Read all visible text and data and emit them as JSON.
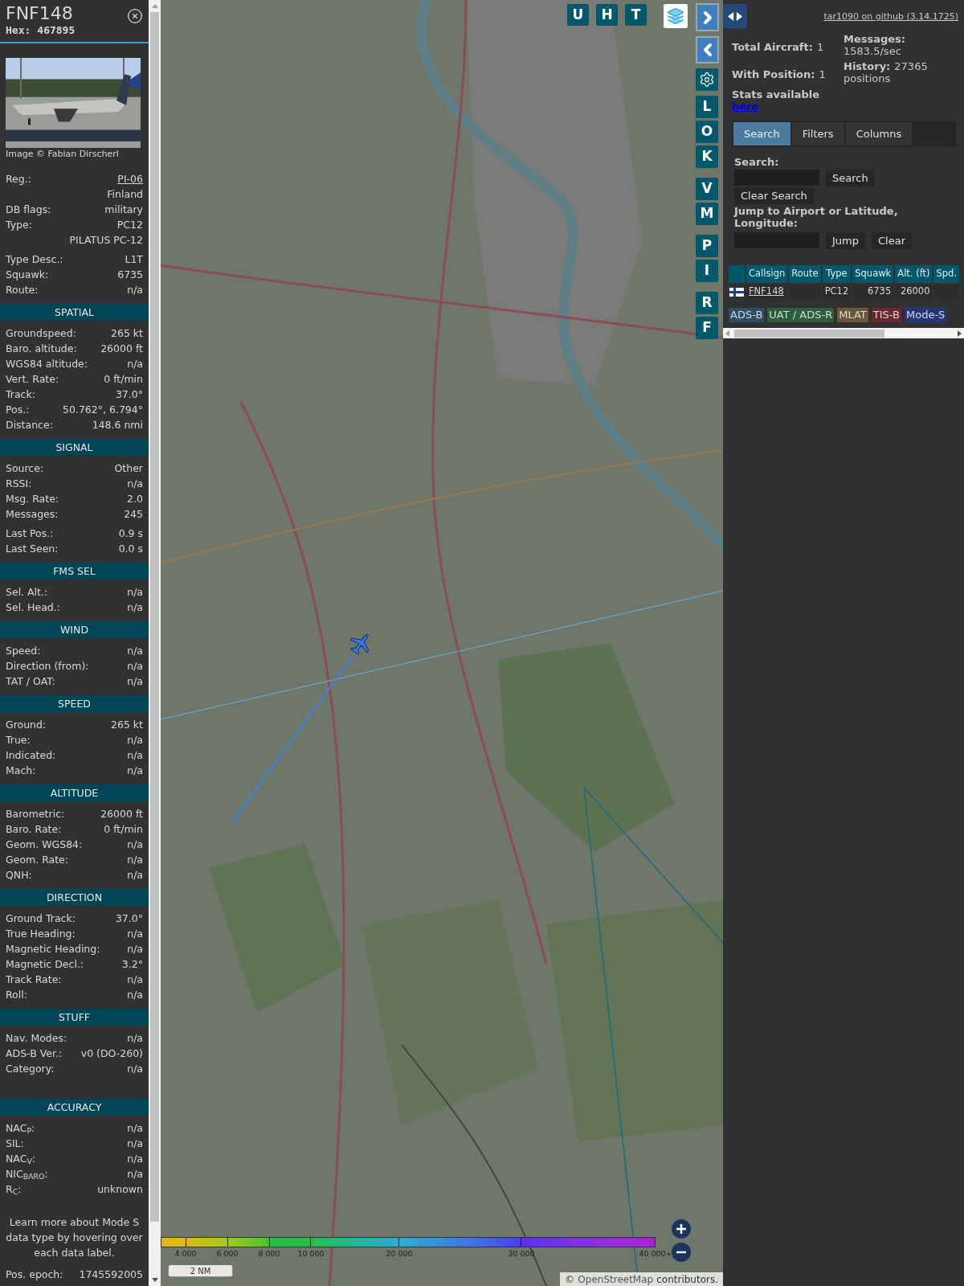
{
  "sidebar": {
    "callsign": "FNF148",
    "hex_label": "Hex:",
    "hex": "467895",
    "photo_credit": "Image © Fabian Dirscherl",
    "groups": [
      [
        {
          "label": "Reg.:",
          "values": [
            "PI-06",
            "Finland"
          ],
          "link": true
        },
        {
          "label": "DB flags:",
          "values": [
            "military"
          ]
        },
        {
          "label": "Type:",
          "values": [
            "PC12",
            "PILATUS PC-12"
          ]
        }
      ],
      [
        {
          "label": "Type Desc.:",
          "values": [
            "L1T"
          ]
        },
        {
          "label": "Squawk:",
          "values": [
            "6735"
          ]
        },
        {
          "label": "Route:",
          "values": [
            "n/a"
          ]
        }
      ]
    ],
    "sections": [
      {
        "title": "SPATIAL",
        "groups": [
          [
            {
              "label": "Groundspeed:",
              "values": [
                "265 kt"
              ]
            },
            {
              "label": "Baro. altitude:",
              "values": [
                "26000 ft"
              ]
            },
            {
              "label": "WGS84 altitude:",
              "values": [
                "n/a"
              ]
            },
            {
              "label": "Vert. Rate:",
              "values": [
                "0 ft/min"
              ]
            },
            {
              "label": "Track:",
              "values": [
                "37.0°"
              ]
            },
            {
              "label": "Pos.:",
              "values": [
                "50.762°, 6.794°"
              ]
            },
            {
              "label": "Distance:",
              "values": [
                "148.6 nmi"
              ]
            }
          ]
        ]
      },
      {
        "title": "SIGNAL",
        "groups": [
          [
            {
              "label": "Source:",
              "values": [
                "Other"
              ]
            },
            {
              "label": "RSSI:",
              "values": [
                "n/a"
              ]
            },
            {
              "label": "Msg. Rate:",
              "values": [
                "2.0"
              ]
            },
            {
              "label": "Messages:",
              "values": [
                "245"
              ]
            }
          ],
          [
            {
              "label": "Last Pos.:",
              "values": [
                "0.9 s"
              ]
            },
            {
              "label": "Last Seen:",
              "values": [
                "0.0 s"
              ]
            }
          ]
        ]
      },
      {
        "title": "FMS SEL",
        "groups": [
          [
            {
              "label": "Sel. Alt.:",
              "values": [
                "n/a"
              ]
            },
            {
              "label": "Sel. Head.:",
              "values": [
                "n/a"
              ]
            }
          ]
        ]
      },
      {
        "title": "WIND",
        "groups": [
          [
            {
              "label": "Speed:",
              "values": [
                "n/a"
              ]
            },
            {
              "label": "Direction (from):",
              "values": [
                "n/a"
              ]
            },
            {
              "label": "TAT / OAT:",
              "values": [
                "n/a"
              ]
            }
          ]
        ]
      },
      {
        "title": "SPEED",
        "groups": [
          [
            {
              "label": "Ground:",
              "values": [
                "265 kt"
              ]
            },
            {
              "label": "True:",
              "values": [
                "n/a"
              ]
            },
            {
              "label": "Indicated:",
              "values": [
                "n/a"
              ]
            },
            {
              "label": "Mach:",
              "values": [
                "n/a"
              ]
            }
          ]
        ]
      },
      {
        "title": "ALTITUDE",
        "groups": [
          [
            {
              "label": "Barometric:",
              "values": [
                "26000 ft"
              ]
            },
            {
              "label": "Baro. Rate:",
              "values": [
                "0 ft/min"
              ]
            },
            {
              "label": "Geom. WGS84:",
              "values": [
                "n/a"
              ]
            },
            {
              "label": "Geom. Rate:",
              "values": [
                "n/a"
              ]
            },
            {
              "label": "QNH:",
              "values": [
                "n/a"
              ]
            }
          ]
        ]
      },
      {
        "title": "DIRECTION",
        "groups": [
          [
            {
              "label": "Ground Track:",
              "values": [
                "37.0°"
              ]
            },
            {
              "label": "True Heading:",
              "values": [
                "n/a"
              ]
            },
            {
              "label": "Magnetic Heading:",
              "values": [
                "n/a"
              ]
            },
            {
              "label": "Magnetic Decl.:",
              "values": [
                "3.2°"
              ]
            },
            {
              "label": "Track Rate:",
              "values": [
                "n/a"
              ]
            },
            {
              "label": "Roll:",
              "values": [
                "n/a"
              ]
            }
          ]
        ]
      },
      {
        "title": "STUFF",
        "groups": [
          [
            {
              "label": "Nav. Modes:",
              "values": [
                "n/a"
              ]
            },
            {
              "label": "ADS-B Ver.:",
              "values": [
                "v0 (DO-260)"
              ]
            },
            {
              "label": "Category:",
              "values": [
                "n/a"
              ]
            }
          ]
        ]
      },
      {
        "title": "ACCURACY",
        "groups": [
          [
            {
              "label": "NAC$_{P}$:",
              "values": [
                "n/a"
              ]
            },
            {
              "label": "SIL:",
              "values": [
                "n/a"
              ]
            },
            {
              "label": "NAC$_{V}$:",
              "values": [
                "n/a"
              ]
            },
            {
              "label": "NIC$_{BARO}$:",
              "values": [
                "n/a"
              ]
            },
            {
              "label": "R$_{C}$:",
              "values": [
                "unknown"
              ]
            }
          ]
        ]
      }
    ],
    "note": "Learn more about Mode S data type by hovering over each data label.",
    "footer_rows": [
      {
        "label": "Pos. epoch:",
        "values": [
          "1745592005"
        ]
      }
    ]
  },
  "map": {
    "top_buttons": [
      "U",
      "H",
      "T"
    ],
    "side_groups": [
      [
        "L",
        "O",
        "K"
      ],
      [
        "V",
        "M"
      ],
      [
        "P",
        "I"
      ],
      [
        "R",
        "F"
      ]
    ],
    "legend_labels": [
      "4 000",
      "6 000",
      "8 000",
      "10 000",
      "20 000",
      "30 000",
      "40 000+"
    ],
    "scale": "2 NM",
    "attribution_prefix": "©",
    "attribution_link": "OpenStreetMap",
    "attribution_suffix": "contributors."
  },
  "panel": {
    "github_link": "tar1090 on github (3.14.1725)",
    "stats_left": [
      {
        "label": "Total Aircraft:",
        "value": "1"
      },
      {
        "label": "With Position:",
        "value": "1"
      }
    ],
    "stats_right": [
      {
        "label": "Messages:",
        "note": "1583.5/sec"
      },
      {
        "label": "History:",
        "value": "27365",
        "note": "positions"
      }
    ],
    "stats_note": "Stats available",
    "stats_link": "here",
    "tabs": [
      {
        "label": "Search",
        "selected": true
      },
      {
        "label": "Filters",
        "selected": false
      },
      {
        "label": "Columns",
        "selected": false
      }
    ],
    "search": {
      "label": "Search:",
      "button": "Search",
      "clear_button": "Clear Search"
    },
    "jump": {
      "label": "Jump to Airport or Latitude, Longitude:",
      "button": "Jump",
      "clear_button": "Clear"
    },
    "table": {
      "columns": [
        "Callsign",
        "Route",
        "Type",
        "Squawk",
        "Alt. (ft)",
        "Spd."
      ],
      "rows": [
        {
          "callsign": "FNF148",
          "type": "PC12",
          "squawk": "6735",
          "altitude": "26000"
        }
      ]
    },
    "sources": [
      {
        "label": "ADS-B",
        "color": "#2d4e66"
      },
      {
        "label": "UAT / ADS-R",
        "color": "#2c5e3c"
      },
      {
        "label": "MLAT",
        "color": "#6a5638"
      },
      {
        "label": "TIS-B",
        "color": "#6c2733"
      },
      {
        "label": "Mode-S",
        "color": "#24367a"
      }
    ]
  }
}
